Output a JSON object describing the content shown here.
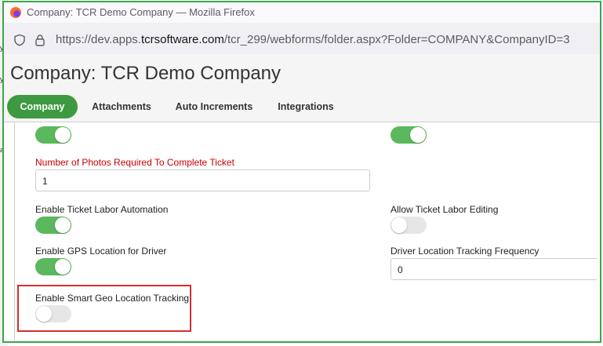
{
  "window": {
    "title": "Company: TCR Demo Company — Mozilla Firefox"
  },
  "browser": {
    "url_prefix": "https://dev.apps.",
    "url_host": "tcrsoftware.com",
    "url_path": "/tcr_299/webforms/folder.aspx?Folder=COMPANY&CompanyID=3",
    "icons": [
      "firefox-logo",
      "shield-icon",
      "lock-icon"
    ]
  },
  "page": {
    "title": "Company: TCR Demo Company"
  },
  "tabs": [
    {
      "label": "Company",
      "active": true
    },
    {
      "label": "Attachments",
      "active": false
    },
    {
      "label": "Auto Increments",
      "active": false
    },
    {
      "label": "Integrations",
      "active": false
    }
  ],
  "form": {
    "photos_required": {
      "label": "Number of Photos Required To Complete Ticket",
      "value": "1"
    },
    "enable_ticket_labor_automation": {
      "label": "Enable Ticket Labor Automation",
      "checked": true
    },
    "allow_ticket_labor_editing": {
      "label": "Allow Ticket Labor Editing",
      "checked": false
    },
    "enable_gps_location": {
      "label": "Enable GPS Location for Driver",
      "checked": true
    },
    "driver_location_frequency": {
      "label": "Driver Location Tracking Frequency",
      "value": "0"
    },
    "enable_smart_geo": {
      "label": "Enable Smart Geo Location Tracking",
      "checked": false
    },
    "top_left_toggle_checked": true,
    "top_right_toggle_checked": true
  },
  "colors": {
    "accent_green": "#3d9a40",
    "toggle_on": "#5cb85c",
    "required_label": "#cc0000",
    "highlight_border": "#d32f2f",
    "window_border": "#3aa64a"
  }
}
